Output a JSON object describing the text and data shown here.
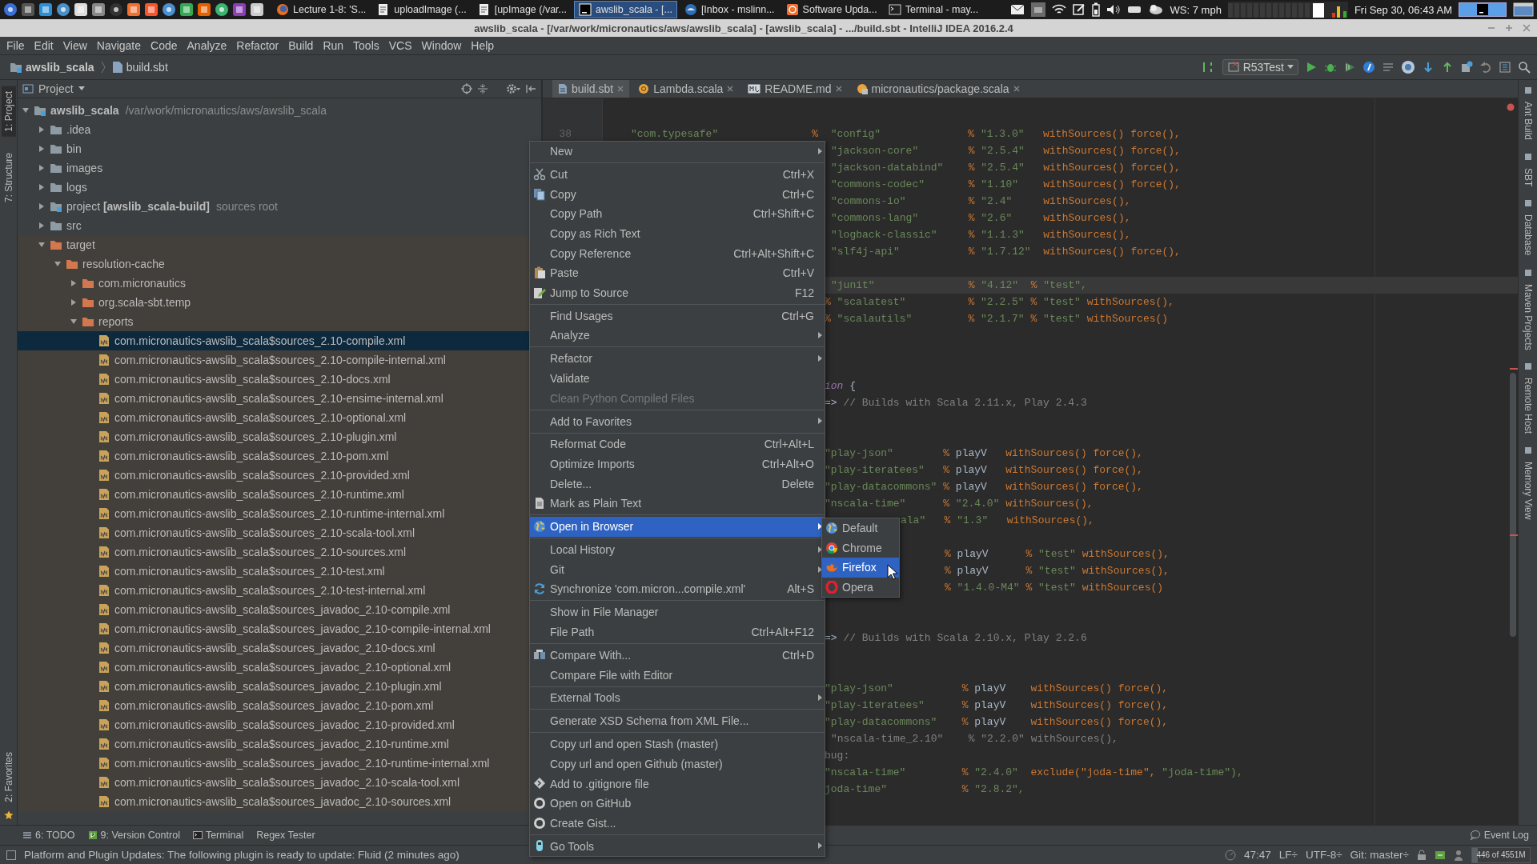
{
  "taskbar": {
    "tasks": [
      {
        "label": "Lecture 1-8: 'S...",
        "kind": "browser",
        "selected": false
      },
      {
        "label": "uploadImage (...",
        "kind": "editor",
        "selected": false
      },
      {
        "label": "[upImage (/var...",
        "kind": "editor",
        "selected": false
      },
      {
        "label": "awslib_scala - [...",
        "kind": "ide",
        "selected": true
      },
      {
        "label": "[Inbox - mslinn...",
        "kind": "mail",
        "selected": false
      },
      {
        "label": "Software Upda...",
        "kind": "update",
        "selected": false
      },
      {
        "label": "Terminal - may...",
        "kind": "terminal",
        "selected": false
      }
    ],
    "weather": "WS: 7 mph",
    "clock": "Fri Sep 30, 06:43 AM"
  },
  "window": {
    "title": "awslib_scala - [/var/work/micronautics/aws/awslib_scala] - [awslib_scala] - .../build.sbt - IntelliJ IDEA 2016.2.4"
  },
  "menu_bar": [
    "File",
    "Edit",
    "View",
    "Navigate",
    "Code",
    "Analyze",
    "Refactor",
    "Build",
    "Run",
    "Tools",
    "VCS",
    "Window",
    "Help"
  ],
  "nav_bar": {
    "crumbs": [
      {
        "label": "awslib_scala",
        "kind": "module"
      },
      {
        "label": "build.sbt",
        "kind": "file"
      }
    ],
    "run_config": "R53Test"
  },
  "left_tool_strip": {
    "top": [
      {
        "label": "1: Project",
        "selected": true
      },
      {
        "label": "7: Structure",
        "selected": false
      }
    ],
    "bottom": [
      {
        "label": "2: Favorites",
        "selected": false
      }
    ]
  },
  "project_panel": {
    "title": "Project",
    "tree": [
      {
        "label": "awslib_scala",
        "note": "/var/work/micronautics/aws/awslib_scala",
        "kind": "root",
        "expanded": true,
        "selected": false,
        "children": [
          {
            "label": ".idea",
            "kind": "folder",
            "expanded": false,
            "selected": false
          },
          {
            "label": "bin",
            "kind": "folder",
            "expanded": false,
            "selected": false
          },
          {
            "label": "images",
            "kind": "folder",
            "expanded": false,
            "selected": false
          },
          {
            "label": "logs",
            "kind": "folder",
            "expanded": false,
            "selected": false
          },
          {
            "label": "project **[awslib_scala-build]**",
            "note": "sources root",
            "kind": "module",
            "expanded": false,
            "selected": false
          },
          {
            "label": "src",
            "kind": "folder",
            "expanded": false,
            "selected": false
          },
          {
            "label": "target",
            "kind": "excluded",
            "expanded": true,
            "selected": false,
            "children": [
              {
                "label": "resolution-cache",
                "kind": "excluded",
                "expanded": true,
                "selected": false,
                "children": [
                  {
                    "label": "com.micronautics",
                    "kind": "excluded",
                    "expanded": false,
                    "selected": false
                  },
                  {
                    "label": "org.scala-sbt.temp",
                    "kind": "excluded",
                    "expanded": false,
                    "selected": false
                  },
                  {
                    "label": "reports",
                    "kind": "excluded",
                    "expanded": true,
                    "selected": false,
                    "children": [
                      {
                        "label": "com.micronautics-awslib_scala$sources_2.10-compile.xml",
                        "kind": "xml",
                        "selected": true
                      },
                      {
                        "label": "com.micronautics-awslib_scala$sources_2.10-compile-internal.xml",
                        "kind": "xml",
                        "selected": false
                      },
                      {
                        "label": "com.micronautics-awslib_scala$sources_2.10-docs.xml",
                        "kind": "xml",
                        "selected": false
                      },
                      {
                        "label": "com.micronautics-awslib_scala$sources_2.10-ensime-internal.xml",
                        "kind": "xml",
                        "selected": false
                      },
                      {
                        "label": "com.micronautics-awslib_scala$sources_2.10-optional.xml",
                        "kind": "xml",
                        "selected": false
                      },
                      {
                        "label": "com.micronautics-awslib_scala$sources_2.10-plugin.xml",
                        "kind": "xml",
                        "selected": false
                      },
                      {
                        "label": "com.micronautics-awslib_scala$sources_2.10-pom.xml",
                        "kind": "xml",
                        "selected": false
                      },
                      {
                        "label": "com.micronautics-awslib_scala$sources_2.10-provided.xml",
                        "kind": "xml",
                        "selected": false
                      },
                      {
                        "label": "com.micronautics-awslib_scala$sources_2.10-runtime.xml",
                        "kind": "xml",
                        "selected": false
                      },
                      {
                        "label": "com.micronautics-awslib_scala$sources_2.10-runtime-internal.xml",
                        "kind": "xml",
                        "selected": false
                      },
                      {
                        "label": "com.micronautics-awslib_scala$sources_2.10-scala-tool.xml",
                        "kind": "xml",
                        "selected": false
                      },
                      {
                        "label": "com.micronautics-awslib_scala$sources_2.10-sources.xml",
                        "kind": "xml",
                        "selected": false
                      },
                      {
                        "label": "com.micronautics-awslib_scala$sources_2.10-test.xml",
                        "kind": "xml",
                        "selected": false
                      },
                      {
                        "label": "com.micronautics-awslib_scala$sources_2.10-test-internal.xml",
                        "kind": "xml",
                        "selected": false
                      },
                      {
                        "label": "com.micronautics-awslib_scala$sources_javadoc_2.10-compile.xml",
                        "kind": "xml",
                        "selected": false
                      },
                      {
                        "label": "com.micronautics-awslib_scala$sources_javadoc_2.10-compile-internal.xml",
                        "kind": "xml",
                        "selected": false
                      },
                      {
                        "label": "com.micronautics-awslib_scala$sources_javadoc_2.10-docs.xml",
                        "kind": "xml",
                        "selected": false
                      },
                      {
                        "label": "com.micronautics-awslib_scala$sources_javadoc_2.10-optional.xml",
                        "kind": "xml",
                        "selected": false
                      },
                      {
                        "label": "com.micronautics-awslib_scala$sources_javadoc_2.10-plugin.xml",
                        "kind": "xml",
                        "selected": false
                      },
                      {
                        "label": "com.micronautics-awslib_scala$sources_javadoc_2.10-pom.xml",
                        "kind": "xml",
                        "selected": false
                      },
                      {
                        "label": "com.micronautics-awslib_scala$sources_javadoc_2.10-provided.xml",
                        "kind": "xml",
                        "selected": false
                      },
                      {
                        "label": "com.micronautics-awslib_scala$sources_javadoc_2.10-runtime.xml",
                        "kind": "xml",
                        "selected": false
                      },
                      {
                        "label": "com.micronautics-awslib_scala$sources_javadoc_2.10-runtime-internal.xml",
                        "kind": "xml",
                        "selected": false
                      },
                      {
                        "label": "com.micronautics-awslib_scala$sources_javadoc_2.10-scala-tool.xml",
                        "kind": "xml",
                        "selected": false
                      },
                      {
                        "label": "com.micronautics-awslib_scala$sources_javadoc_2.10-sources.xml",
                        "kind": "xml",
                        "selected": false
                      }
                    ]
                  }
                ]
              }
            ]
          }
        ]
      }
    ]
  },
  "editor": {
    "tabs": [
      {
        "label": "build.sbt",
        "kind": "sbt",
        "selected": true
      },
      {
        "label": "Lambda.scala",
        "kind": "object",
        "selected": false
      },
      {
        "label": "README.md",
        "kind": "markdown",
        "selected": false
      },
      {
        "label": "micronautics/package.scala",
        "kind": "package",
        "selected": false
      }
    ],
    "lines": [
      {
        "kind": "first",
        "number": "38",
        "text": "\"com.typesafe\"               %  \"config\"              % \"1.3.0\"   withSources() force(),",
        "current": false
      },
      {
        "kind": "indented",
        "text": "\"jackson-core\"        % \"2.5.4\"   withSources() force(),",
        "current": false
      },
      {
        "kind": "indented",
        "text": "\"jackson-databind\"    % \"2.5.4\"   withSources() force(),",
        "current": false
      },
      {
        "kind": "indented",
        "text": "\"commons-codec\"       % \"1.10\"    withSources() force(),",
        "current": false
      },
      {
        "kind": "indented",
        "text": "\"commons-io\"          % \"2.4\"     withSources(),",
        "current": false
      },
      {
        "kind": "indented",
        "text": "\"commons-lang\"        % \"2.6\"     withSources(),",
        "current": false
      },
      {
        "kind": "indented",
        "text": "\"logback-classic\"     % \"1.1.3\"   withSources(),",
        "current": false
      },
      {
        "kind": "indented",
        "text": "\"slf4j-api\"           % \"1.7.12\"  withSources() force(),",
        "current": false
      },
      {
        "kind": "blank",
        "current": false
      },
      {
        "kind": "indented",
        "text": "\"junit\"               % \"4.12\"  % \"test\",",
        "current": true
      },
      {
        "kind": "code",
        "text": "% \"scalatest\"          % \"2.2.5\" % \"test\" withSources(),",
        "current": false
      },
      {
        "kind": "code",
        "text": "% \"scalautils\"         % \"2.1.7\" % \"test\" withSources()",
        "current": false
      },
      {
        "kind": "blank",
        "current": false
      },
      {
        "kind": "blank",
        "current": false
      },
      {
        "kind": "blank",
        "current": false
      },
      {
        "kind": "code",
        "declaration": true,
        "text": "ion {",
        "current": false
      },
      {
        "kind": "code",
        "text": "=> // Builds with Scala 2.11.x, Play 2.4.3",
        "current": false
      },
      {
        "kind": "blank",
        "current": false
      },
      {
        "kind": "blank",
        "current": false
      },
      {
        "kind": "edge",
        "text": "\"play-json\"        % playV   withSources() force(),",
        "current": false
      },
      {
        "kind": "edge",
        "text": "\"play-iteratees\"   % playV   withSources() force(),",
        "current": false
      },
      {
        "kind": "edge",
        "text": "\"play-datacommons\" % playV   withSources() force(),",
        "current": false
      },
      {
        "kind": "edge",
        "text": "\"nscala-time\"      % \"2.4.0\" withSources(),",
        "current": false
      },
      {
        "kind": "beside_submenu",
        "text": "ala\"   % \"1.3\"   withSources(),",
        "current": false
      },
      {
        "kind": "blank",
        "current": false
      },
      {
        "kind": "aligned",
        "text": "% playV      % \"test\" withSources(),",
        "current": false
      },
      {
        "kind": "aligned",
        "text": "% playV      % \"test\" withSources(),",
        "current": false
      },
      {
        "kind": "aligned",
        "text": "% \"1.4.0-M4\" % \"test\" withSources()",
        "current": false
      },
      {
        "kind": "blank",
        "current": false
      },
      {
        "kind": "blank",
        "current": false
      },
      {
        "kind": "code",
        "text": "=> // Builds with Scala 2.10.x, Play 2.2.6",
        "current": false
      },
      {
        "kind": "blank",
        "current": false
      },
      {
        "kind": "blank",
        "current": false
      },
      {
        "kind": "edge",
        "text": "\"play-json\"           % playV    withSources() force(),",
        "current": false
      },
      {
        "kind": "edge",
        "text": "\"play-iteratees\"      % playV    withSources() force(),",
        "current": false
      },
      {
        "kind": "edge",
        "text": "\"play-datacommons\"    % playV    withSources() force(),",
        "current": false
      },
      {
        "kind": "indented",
        "commented": true,
        "text": "\"nscala-time_2.10\"    % \"2.2.0\" withSources(),",
        "current": false
      },
      {
        "kind": "edge",
        "commented": true,
        "text": "bug:",
        "current": false
      },
      {
        "kind": "edge",
        "text": "\"nscala-time\"         % \"2.4.0\"  exclude(\"joda-time\", \"joda-time\"),",
        "current": false
      },
      {
        "kind": "edge",
        "text": "joda-time\"            % \"2.8.2\",",
        "current": false
      }
    ]
  },
  "right_tool_strip": [
    "Ant Build",
    "SBT",
    "Database",
    "Maven Projects",
    "Remote Host",
    "Memory View"
  ],
  "context_menu": {
    "groups": [
      [
        {
          "label": "New",
          "kind": "plain",
          "submenu": true,
          "selected": false,
          "disabled": false
        }
      ],
      [
        {
          "label": "Cut",
          "shortcut": "Ctrl+X",
          "kind": "cut",
          "submenu": false,
          "selected": false,
          "disabled": false
        },
        {
          "label": "Copy",
          "shortcut": "Ctrl+C",
          "kind": "copy",
          "submenu": false,
          "selected": false,
          "disabled": false
        },
        {
          "label": "Copy Path",
          "shortcut": "Ctrl+Shift+C",
          "kind": "plain",
          "submenu": false,
          "selected": false,
          "disabled": false
        },
        {
          "label": "Copy as Rich Text",
          "kind": "plain",
          "submenu": false,
          "selected": false,
          "disabled": false
        },
        {
          "label": "Copy Reference",
          "shortcut": "Ctrl+Alt+Shift+C",
          "kind": "plain",
          "submenu": false,
          "selected": false,
          "disabled": false
        },
        {
          "label": "Paste",
          "shortcut": "Ctrl+V",
          "kind": "paste",
          "submenu": false,
          "selected": false,
          "disabled": false
        },
        {
          "label": "Jump to Source",
          "shortcut": "F12",
          "kind": "edit",
          "submenu": false,
          "selected": false,
          "disabled": false
        }
      ],
      [
        {
          "label": "Find Usages",
          "shortcut": "Ctrl+G",
          "kind": "plain",
          "submenu": false,
          "selected": false,
          "disabled": false
        },
        {
          "label": "Analyze",
          "kind": "plain",
          "submenu": true,
          "selected": false,
          "disabled": false
        }
      ],
      [
        {
          "label": "Refactor",
          "kind": "plain",
          "submenu": true,
          "selected": false,
          "disabled": false
        },
        {
          "label": "Validate",
          "kind": "plain",
          "submenu": false,
          "selected": false,
          "disabled": false
        },
        {
          "label": "Clean Python Compiled Files",
          "kind": "plain",
          "submenu": false,
          "selected": false,
          "disabled": true
        }
      ],
      [
        {
          "label": "Add to Favorites",
          "kind": "plain",
          "submenu": true,
          "selected": false,
          "disabled": false
        }
      ],
      [
        {
          "label": "Reformat Code",
          "shortcut": "Ctrl+Alt+L",
          "kind": "plain",
          "submenu": false,
          "selected": false,
          "disabled": false
        },
        {
          "label": "Optimize Imports",
          "shortcut": "Ctrl+Alt+O",
          "kind": "plain",
          "submenu": false,
          "selected": false,
          "disabled": false
        },
        {
          "label": "Delete...",
          "shortcut": "Delete",
          "kind": "plain",
          "submenu": false,
          "selected": false,
          "disabled": false
        },
        {
          "label": "Mark as Plain Text",
          "kind": "text",
          "submenu": false,
          "selected": false,
          "disabled": false
        }
      ],
      [
        {
          "label": "Open in Browser",
          "kind": "globe",
          "submenu": true,
          "selected": true,
          "disabled": false
        }
      ],
      [
        {
          "label": "Local History",
          "kind": "plain",
          "submenu": true,
          "selected": false,
          "disabled": false
        },
        {
          "label": "Git",
          "kind": "plain",
          "submenu": true,
          "selected": false,
          "disabled": false
        },
        {
          "label": "Synchronize 'com.micron...compile.xml'",
          "shortcut": "Alt+S",
          "kind": "sync",
          "submenu": false,
          "selected": false,
          "disabled": false
        }
      ],
      [
        {
          "label": "Show in File Manager",
          "kind": "plain",
          "submenu": false,
          "selected": false,
          "disabled": false
        },
        {
          "label": "File Path",
          "shortcut": "Ctrl+Alt+F12",
          "kind": "plain",
          "submenu": false,
          "selected": false,
          "disabled": false
        }
      ],
      [
        {
          "label": "Compare With...",
          "shortcut": "Ctrl+D",
          "kind": "compare",
          "submenu": false,
          "selected": false,
          "disabled": false
        },
        {
          "label": "Compare File with Editor",
          "kind": "plain",
          "submenu": false,
          "selected": false,
          "disabled": false
        }
      ],
      [
        {
          "label": "External Tools",
          "kind": "plain",
          "submenu": true,
          "selected": false,
          "disabled": false
        }
      ],
      [
        {
          "label": "Generate XSD Schema from XML File...",
          "kind": "plain",
          "submenu": false,
          "selected": false,
          "disabled": false
        }
      ],
      [
        {
          "label": "Copy url and open Stash (master)",
          "kind": "plain",
          "submenu": false,
          "selected": false,
          "disabled": false
        },
        {
          "label": "Copy url and open Github (master)",
          "kind": "plain",
          "submenu": false,
          "selected": false,
          "disabled": false
        },
        {
          "label": "Add to .gitignore file",
          "kind": "ignore",
          "submenu": false,
          "selected": false,
          "disabled": false
        },
        {
          "label": "Open on GitHub",
          "kind": "hub",
          "submenu": false,
          "selected": false,
          "disabled": false
        },
        {
          "label": "Create Gist...",
          "kind": "hub",
          "submenu": false,
          "selected": false,
          "disabled": false
        }
      ],
      [
        {
          "label": "Go Tools",
          "kind": "go",
          "submenu": true,
          "selected": false,
          "disabled": false
        }
      ]
    ]
  },
  "browser_submenu": {
    "items": [
      {
        "label": "Default",
        "kind": "globe",
        "selected": false
      },
      {
        "label": "Chrome",
        "kind": "chrome",
        "selected": false
      },
      {
        "label": "Firefox",
        "kind": "firefox",
        "selected": true
      },
      {
        "label": "Opera",
        "kind": "opera",
        "selected": false
      }
    ]
  },
  "tool_bar": {
    "left": [
      {
        "label": "6: TODO",
        "kind": "todo"
      },
      {
        "label": "9: Version Control",
        "kind": "vcs"
      },
      {
        "label": "Terminal",
        "kind": "terminal"
      },
      {
        "label": "Regex Tester",
        "kind": "plain"
      }
    ],
    "right": [
      {
        "label": "Event Log",
        "kind": "log"
      }
    ]
  },
  "status_bar": {
    "message": "Platform and Plugin Updates: The following plugin is ready to update: Fluid (2 minutes ago)",
    "position": "47:47",
    "line_separator": "LF÷",
    "encoding": "UTF-8÷",
    "vcs": "Git: master÷",
    "memory": {
      "text": "446 of 4551M",
      "level": 0.1
    }
  }
}
